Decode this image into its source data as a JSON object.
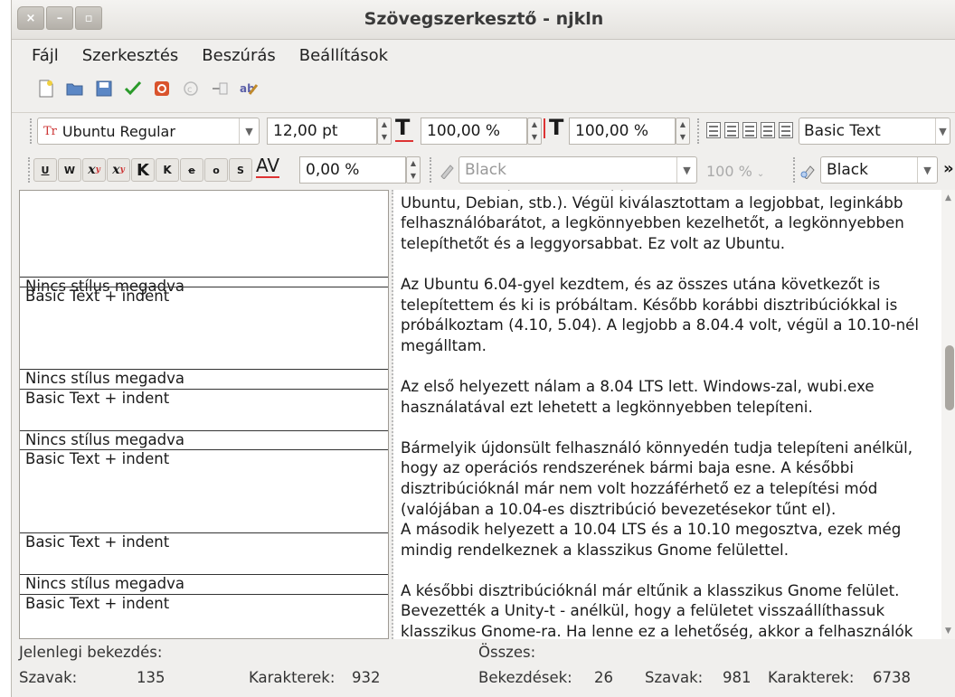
{
  "window": {
    "title": "Szövegszerkesztő - njkln",
    "buttons": [
      "×",
      "–",
      "▫"
    ]
  },
  "menu": [
    "Fájl",
    "Szerkesztés",
    "Beszúrás",
    "Beállítások"
  ],
  "format_toolbar": {
    "font_icon": "Tr",
    "font": "Ubuntu Regular",
    "size": "12,00 pt",
    "scale_h": "100,00 %",
    "scale_v": "100,00 %",
    "style": "Basic Text"
  },
  "char_toolbar": {
    "spacing": "0,00 %",
    "fill_color": "Black",
    "opacity": "100 %",
    "stroke_color": "Black",
    "more": "»"
  },
  "style_rows": [
    "Nincs stílus megadva",
    "Basic Text + indent",
    "Nincs stílus megadva",
    "Basic Text + indent",
    "Nincs stílus megadva",
    "Basic Text + indent",
    "Basic Text + indent",
    "Nincs stílus megadva",
    "Basic Text + indent"
  ],
  "text": {
    "p0": "disztribúciók (pl. OTTO, Knoppix, Suse, Fedora, Kubuntu, Xubuntu, Ubuntu, Debian, stb.). Végül kiválasztottam a legjobbat, leginkább felhasználóbarátot, a legkönnyebben kezelhetőt, a legkönnyebben telepíthetőt és a leggyorsabbat. Ez volt az Ubuntu.",
    "p1": "Az Ubuntu 6.04-gyel kezdtem, és az összes utána következőt is telepítettem és ki is próbáltam. Később korábbi disztribúciókkal is próbálkoztam (4.10, 5.04). A legjobb a 8.04.4 volt, végül a 10.10-nél megálltam.",
    "p2": "Az első helyezett nálam a 8.04 LTS lett. Windows-zal, wubi.exe használatával ezt lehetett a legkönnyebben telepíteni.",
    "p3": "Bármelyik újdonsült felhasználó könnyedén tudja telepíteni anélkül, hogy az operációs rendszerének bármi baja esne. A későbbi disztribúcióknál már nem volt hozzáférhető ez a telepítési mód (valójában a 10.04-es disztribúció bevezetésekor tűnt el).",
    "p4": "A második helyezett a 10.04 LTS és a 10.10 megosztva, ezek még mindig rendelkeznek a klasszikus Gnome felülettel.",
    "p5": "A későbbi disztribúcióknál már eltűnik a klasszikus Gnome felület. Bevezették a Unity-t - anélkül, hogy a felületet visszaállíthassuk klasszikus Gnome-ra. Ha lenne ez a lehetőség, akkor a felhasználók"
  },
  "status": {
    "current_label": "Jelenlegi bekezdés:",
    "total_label": "Összes:",
    "words_label": "Szavak:",
    "words": "135",
    "chars_label": "Karakterek:",
    "chars": "932",
    "total_paras_label": "Bekezdések:",
    "total_paras": "26",
    "total_words_label": "Szavak:",
    "total_words": "981",
    "total_chars_label": "Karakterek:",
    "total_chars": "6738"
  }
}
